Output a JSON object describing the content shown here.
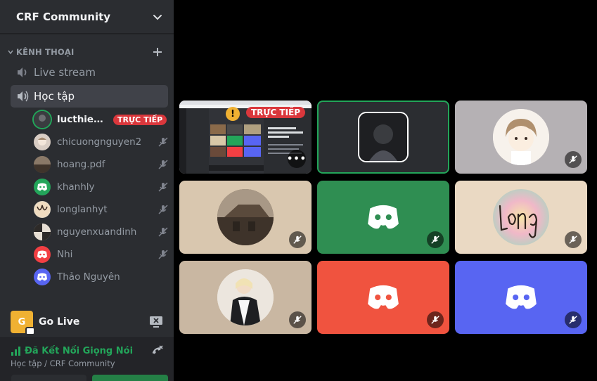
{
  "server": {
    "name": "CRF Community"
  },
  "category": {
    "label": "KÊNH THOẠI"
  },
  "channels": [
    {
      "label": "Live stream",
      "active": false
    },
    {
      "label": "Học tập",
      "active": true
    }
  ],
  "members": [
    {
      "name": "lucthienp...",
      "live": true,
      "badge": "TRỰC TIẾP",
      "avatar_color": "#1e1f22"
    },
    {
      "name": "chicuongnguyen2",
      "avatar_color": "#d9cdc4"
    },
    {
      "name": "hoang.pdf",
      "avatar_color": "#6b5a4a"
    },
    {
      "name": "khanhly",
      "avatar_color": "#23a55a"
    },
    {
      "name": "longlanhyt",
      "avatar_color": "#e8dcc8"
    },
    {
      "name": "nguyenxuandinh",
      "avatar_color": "#c9b8a3"
    },
    {
      "name": "Nhi",
      "avatar_color": "#f23f43"
    },
    {
      "name": "Thảo Nguyên",
      "avatar_color": "#5865f2"
    }
  ],
  "golive": {
    "label": "Go Live",
    "avatar_letter": "G"
  },
  "voice": {
    "status": "Đã Kết Nối Giọng Nói",
    "location": "Học tập / CRF Community"
  },
  "stream_tile": {
    "badge": "TRỰC TIẾP",
    "warn": "!",
    "more": "•••"
  },
  "colors": {
    "accent_green": "#23a55a",
    "live_red": "#da373c",
    "discord_blurple": "#5865f2",
    "discord_red": "#f23f43"
  }
}
